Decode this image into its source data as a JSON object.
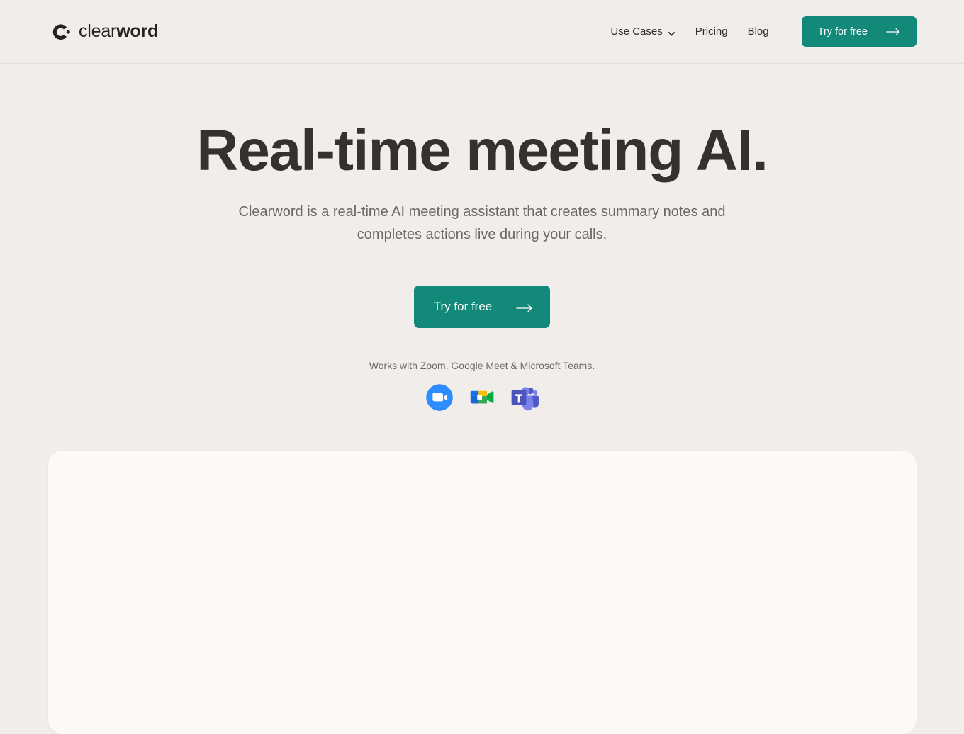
{
  "brand": {
    "name_light": "clear",
    "name_bold": "word",
    "logo_icon": "clearword-c-dot-logo"
  },
  "nav": {
    "items": [
      {
        "label": "Use Cases",
        "has_dropdown": true,
        "icon": "chevron-down-icon"
      },
      {
        "label": "Pricing",
        "has_dropdown": false
      },
      {
        "label": "Blog",
        "has_dropdown": false
      }
    ],
    "cta_label": "Try for free",
    "cta_icon": "arrow-right-icon"
  },
  "hero": {
    "title": "Real-time meeting AI.",
    "subtitle": "Clearword is a real-time AI meeting assistant that creates summary notes and completes actions live during your calls.",
    "cta_label": "Try for free",
    "cta_icon": "arrow-right-icon",
    "works_with": "Works with Zoom, Google Meet & Microsoft Teams.",
    "integrations": [
      {
        "name": "Zoom",
        "icon": "zoom-icon"
      },
      {
        "name": "Google Meet",
        "icon": "google-meet-icon"
      },
      {
        "name": "Microsoft Teams",
        "icon": "microsoft-teams-icon"
      }
    ]
  },
  "colors": {
    "page_background": "#f1edea",
    "accent_teal": "#13897a",
    "heading": "#343230",
    "body_text": "#6b6761",
    "card_background": "#fdf9f7"
  }
}
